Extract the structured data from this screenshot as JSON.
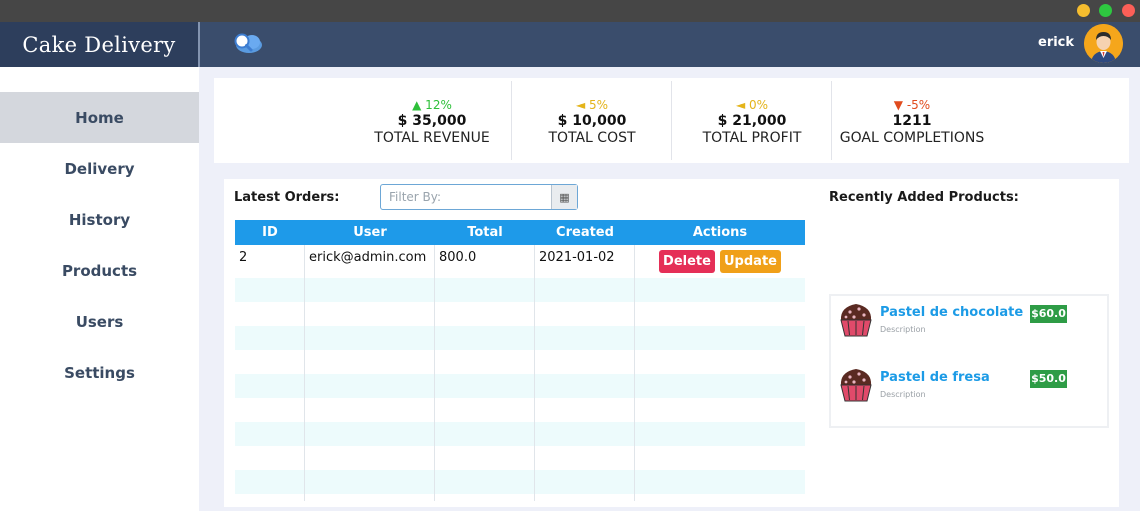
{
  "app": {
    "brand": "Cake Delivery",
    "user_name": "erick"
  },
  "colors": {
    "header": "#3a4d6c",
    "brand_bg": "#2d3e5c",
    "accent": "#1e9ae9",
    "delete": "#e52f57",
    "update": "#f0a019",
    "price": "#2e9c46",
    "up": "#2ec03a",
    "flat": "#e4b41a",
    "down": "#e04b1e"
  },
  "sidebar": {
    "items": [
      {
        "label": "Home",
        "active": true
      },
      {
        "label": "Delivery",
        "active": false
      },
      {
        "label": "History",
        "active": false
      },
      {
        "label": "Products",
        "active": false
      },
      {
        "label": "Users",
        "active": false
      },
      {
        "label": "Settings",
        "active": false
      }
    ]
  },
  "stats": [
    {
      "trend": "up",
      "delta": "▲ 12%",
      "value": "$ 35,000",
      "label": "TOTAL REVENUE"
    },
    {
      "trend": "flat",
      "delta": "◄ 5%",
      "value": "$ 10,000",
      "label": "TOTAL COST"
    },
    {
      "trend": "flat",
      "delta": "◄ 0%",
      "value": "$ 21,000",
      "label": "TOTAL PROFIT"
    },
    {
      "trend": "down",
      "delta": "▼ -5%",
      "value": "1211",
      "label": "GOAL COMPLETIONS"
    }
  ],
  "orders": {
    "title": "Latest Orders:",
    "filter_placeholder": "Filter By:",
    "calendar_icon": "calendar-icon",
    "columns": [
      "ID",
      "User",
      "Total",
      "Created",
      "Actions"
    ],
    "rows": [
      {
        "id": "2",
        "user": "erick@admin.com",
        "total": "800.0",
        "created": "2021-01-02",
        "delete_label": "Delete",
        "update_label": "Update"
      }
    ]
  },
  "products": {
    "title": "Recently Added Products:",
    "items": [
      {
        "name": "Pastel de chocolate",
        "description": "Description",
        "price": "$60.0",
        "icon": "cupcake-icon"
      },
      {
        "name": "Pastel de fresa",
        "description": "Description",
        "price": "$50.0",
        "icon": "cupcake-icon"
      }
    ]
  }
}
